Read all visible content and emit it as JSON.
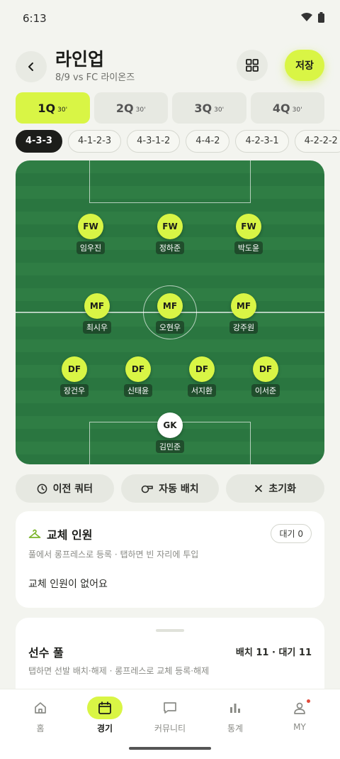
{
  "status_bar": {
    "time": "6:13"
  },
  "header": {
    "title": "라인업",
    "subtitle": "8/9 vs FC 라이온즈",
    "save_label": "저장"
  },
  "quarters": [
    {
      "label": "1Q",
      "minutes": "30'",
      "active": true
    },
    {
      "label": "2Q",
      "minutes": "30'"
    },
    {
      "label": "3Q",
      "minutes": "30'"
    },
    {
      "label": "4Q",
      "minutes": "30'"
    }
  ],
  "formations": [
    "4-3-3",
    "4-1-2-3",
    "4-3-1-2",
    "4-4-2",
    "4-2-3-1",
    "4-2-2-2"
  ],
  "selected_formation": "4-3-3",
  "pitch": {
    "players": [
      {
        "pos": "FW",
        "name": "임우진"
      },
      {
        "pos": "FW",
        "name": "정하준"
      },
      {
        "pos": "FW",
        "name": "박도윤"
      },
      {
        "pos": "MF",
        "name": "최시우"
      },
      {
        "pos": "MF",
        "name": "오현우"
      },
      {
        "pos": "MF",
        "name": "강주원"
      },
      {
        "pos": "DF",
        "name": "장건우"
      },
      {
        "pos": "DF",
        "name": "신태윤"
      },
      {
        "pos": "DF",
        "name": "서지환"
      },
      {
        "pos": "DF",
        "name": "이서준"
      },
      {
        "pos": "GK",
        "name": "김민준"
      }
    ]
  },
  "actions": {
    "previous_quarter": "이전 쿼터",
    "auto_assign": "자동 배치",
    "reset": "초기화"
  },
  "substitutes": {
    "title": "교체 인원",
    "badge": "대기 0",
    "hint": "풀에서 롱프레스로 등록 · 탭하면 빈 자리에 투입",
    "empty": "교체 인원이 없어요"
  },
  "player_pool": {
    "title": "선수 풀",
    "count": "배치 11 · 대기 11",
    "hint": "탭하면 선발 배치·해제 · 롱프레스로 교체 등록·해제"
  },
  "bottom_nav": [
    {
      "label": "홈",
      "icon": "home-icon"
    },
    {
      "label": "경기",
      "icon": "calendar-icon",
      "active": true
    },
    {
      "label": "커뮤니티",
      "icon": "chat-icon"
    },
    {
      "label": "통계",
      "icon": "bar-chart-icon"
    },
    {
      "label": "MY",
      "icon": "person-icon",
      "has_badge": true
    }
  ],
  "colors": {
    "accent": "#d9f545",
    "pitch": "#2f7d44",
    "background": "#f3f4ef"
  }
}
